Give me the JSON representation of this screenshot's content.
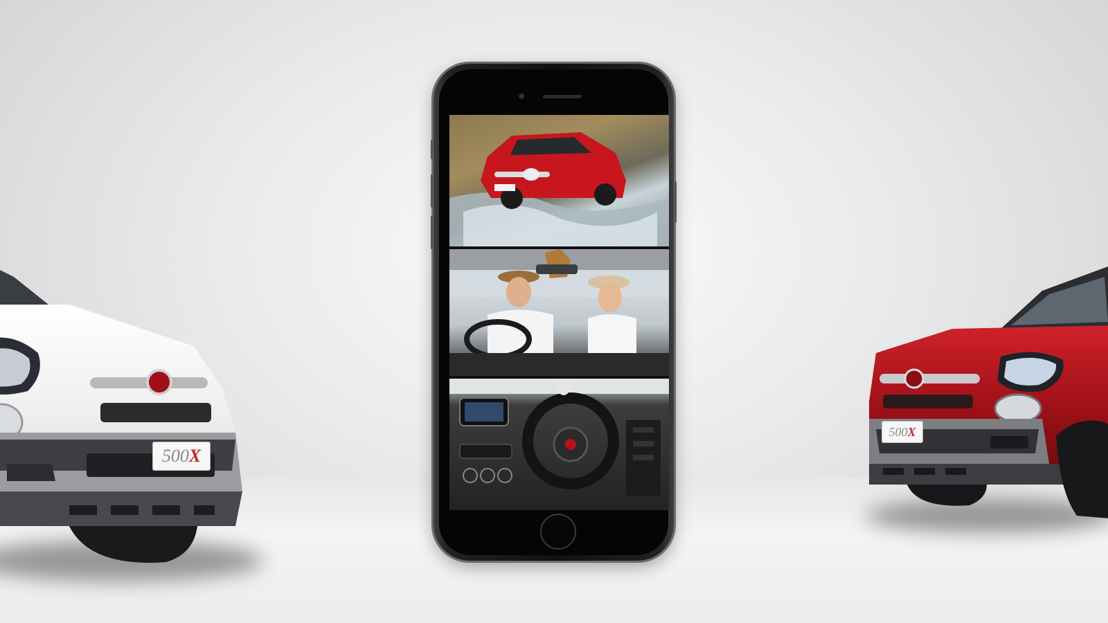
{
  "scene": {
    "left_car": {
      "model_badge": "500",
      "badge_suffix": "X",
      "color": "#f2f2f2"
    },
    "right_car": {
      "model_badge": "500",
      "badge_suffix": "X",
      "color": "#b3141c"
    },
    "phone_panels": [
      "offroad-red-car",
      "couple-driving",
      "dashboard"
    ]
  },
  "colors": {
    "accent_red": "#c1272d",
    "phone_body": "#1a1a1c"
  }
}
